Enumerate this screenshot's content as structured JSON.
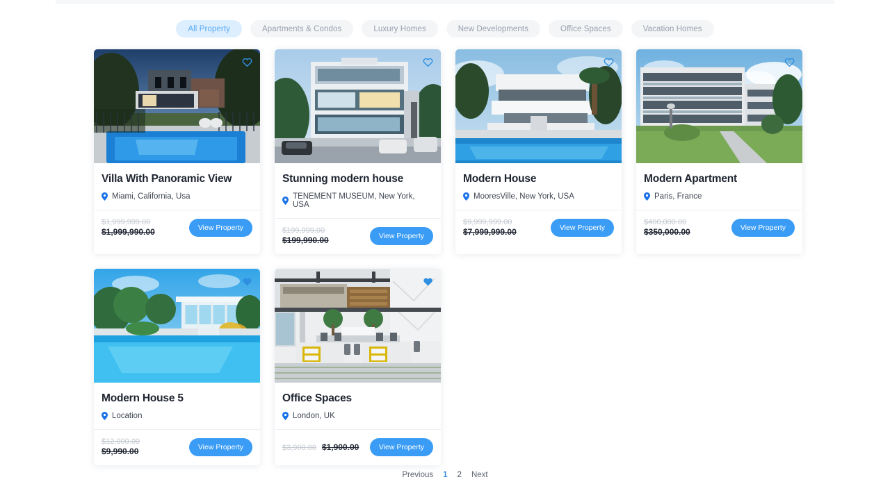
{
  "filters": {
    "items": [
      {
        "label": "All Property",
        "active": true
      },
      {
        "label": "Apartments & Condos",
        "active": false
      },
      {
        "label": "Luxury Homes",
        "active": false
      },
      {
        "label": "New Developments",
        "active": false
      },
      {
        "label": "Office Spaces",
        "active": false
      },
      {
        "label": "Vacation Homes",
        "active": false
      }
    ]
  },
  "colors": {
    "accent": "#3a9cf5",
    "chip_active_bg": "#ddeeff",
    "chip_active_text": "#56aaf5",
    "pin": "#1a73e8",
    "title": "#1e2430",
    "price_old": "#c2c7cf"
  },
  "cards": [
    {
      "title": "Villa With Panoramic View",
      "location": "Miami, California, Usa",
      "price_old": "$1,999,999.00",
      "price_new": "$1,999,990.00",
      "cta": "View Property",
      "favorite": false,
      "price_layout": "stacked",
      "image": "villa-pool-dusk",
      "pin_icon": "map-pin-icon",
      "fav_icon": "heart-outline-icon"
    },
    {
      "title": "Stunning modern house",
      "location": "TENEMENT MUSEUM, New York, USA",
      "price_old": "$199,999.00",
      "price_new": "$199,990.00",
      "cta": "View Property",
      "favorite": false,
      "price_layout": "stacked",
      "image": "glass-modern-house",
      "pin_icon": "map-pin-icon",
      "fav_icon": "heart-outline-icon"
    },
    {
      "title": "Modern House",
      "location": "MooresVille, New York, USA",
      "price_old": "$9,999,999.00",
      "price_new": "$7,999,999.00",
      "cta": "View Property",
      "favorite": false,
      "price_layout": "stacked",
      "image": "white-villa-poolside",
      "pin_icon": "map-pin-icon",
      "fav_icon": "heart-outline-icon"
    },
    {
      "title": "Modern Apartment",
      "location": "Paris, France",
      "price_old": "$400,000.00",
      "price_new": "$350,000.00",
      "cta": "View Property",
      "favorite": false,
      "price_layout": "stacked",
      "image": "apartment-block-lawn",
      "pin_icon": "map-pin-icon",
      "fav_icon": "heart-outline-icon"
    },
    {
      "title": "Modern House 5",
      "location": "Location",
      "price_old": "$12,000.00",
      "price_new": "$9,990.00",
      "cta": "View Property",
      "favorite": true,
      "price_layout": "stacked",
      "image": "tropical-pool-resort",
      "pin_icon": "map-pin-icon",
      "fav_icon": "heart-filled-icon"
    },
    {
      "title": "Office Spaces",
      "location": "London, UK",
      "price_old": "$3,900.00",
      "price_new": "$1,900.00",
      "cta": "View Property",
      "favorite": true,
      "price_layout": "inline",
      "image": "open-plan-office",
      "pin_icon": "map-pin-icon",
      "fav_icon": "heart-filled-icon"
    }
  ],
  "pagination": {
    "previous": "Previous",
    "next": "Next",
    "pages": [
      "1",
      "2"
    ],
    "current": "1"
  }
}
